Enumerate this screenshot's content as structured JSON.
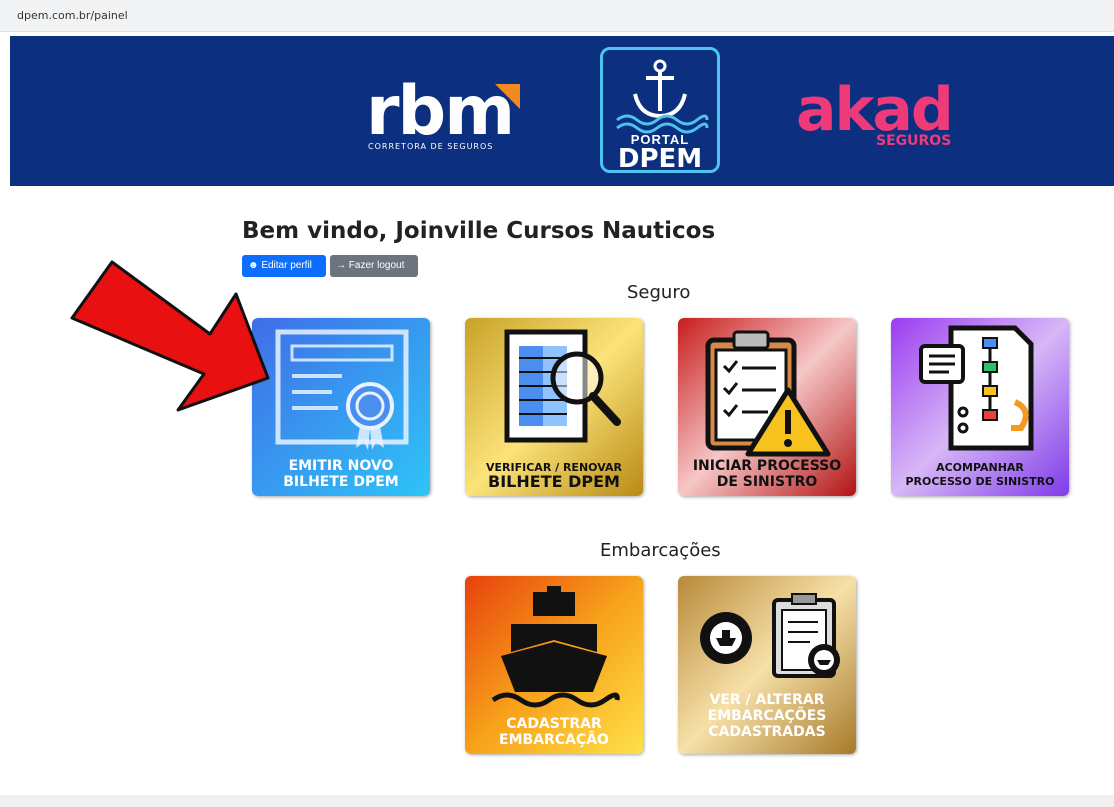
{
  "browser": {
    "url": "dpem.com.br/painel"
  },
  "header": {
    "rbm_logo": "rbm",
    "rbm_sub": "CORRETORA DE SEGUROS",
    "portal_line1": "PORTAL",
    "portal_line2": "DPEM",
    "akad_logo": "akad",
    "akad_sub": "SEGUROS"
  },
  "welcome": "Bem vindo, Joinville Cursos Nauticos",
  "buttons": {
    "edit_profile": "Editar perfil",
    "logout": "Fazer logout"
  },
  "sections": {
    "seguro": {
      "title": "Seguro",
      "tiles": [
        {
          "line1": "EMITIR NOVO",
          "line2": "BILHETE DPEM"
        },
        {
          "line1": "VERIFICAR / RENOVAR",
          "line2": "BILHETE   DPEM"
        },
        {
          "line1": "INICIAR PROCESSO",
          "line2": "DE SINISTRO"
        },
        {
          "line1": "ACOMPANHAR",
          "line2": "PROCESSO DE SINISTRO"
        }
      ]
    },
    "embarcacoes": {
      "title": "Embarcações",
      "tiles": [
        {
          "line1": "CADASTRAR",
          "line2": "EMBARCAÇÃO"
        },
        {
          "line1": "VER / ALTERAR",
          "line2": "EMBARCAÇÕES",
          "line3": "CADASTRADAS"
        }
      ]
    }
  },
  "colors": {
    "banner": "#0d2f80",
    "primary_button": "#0d6efd",
    "secondary_button": "#6c757d",
    "arrow": "#e81010"
  }
}
